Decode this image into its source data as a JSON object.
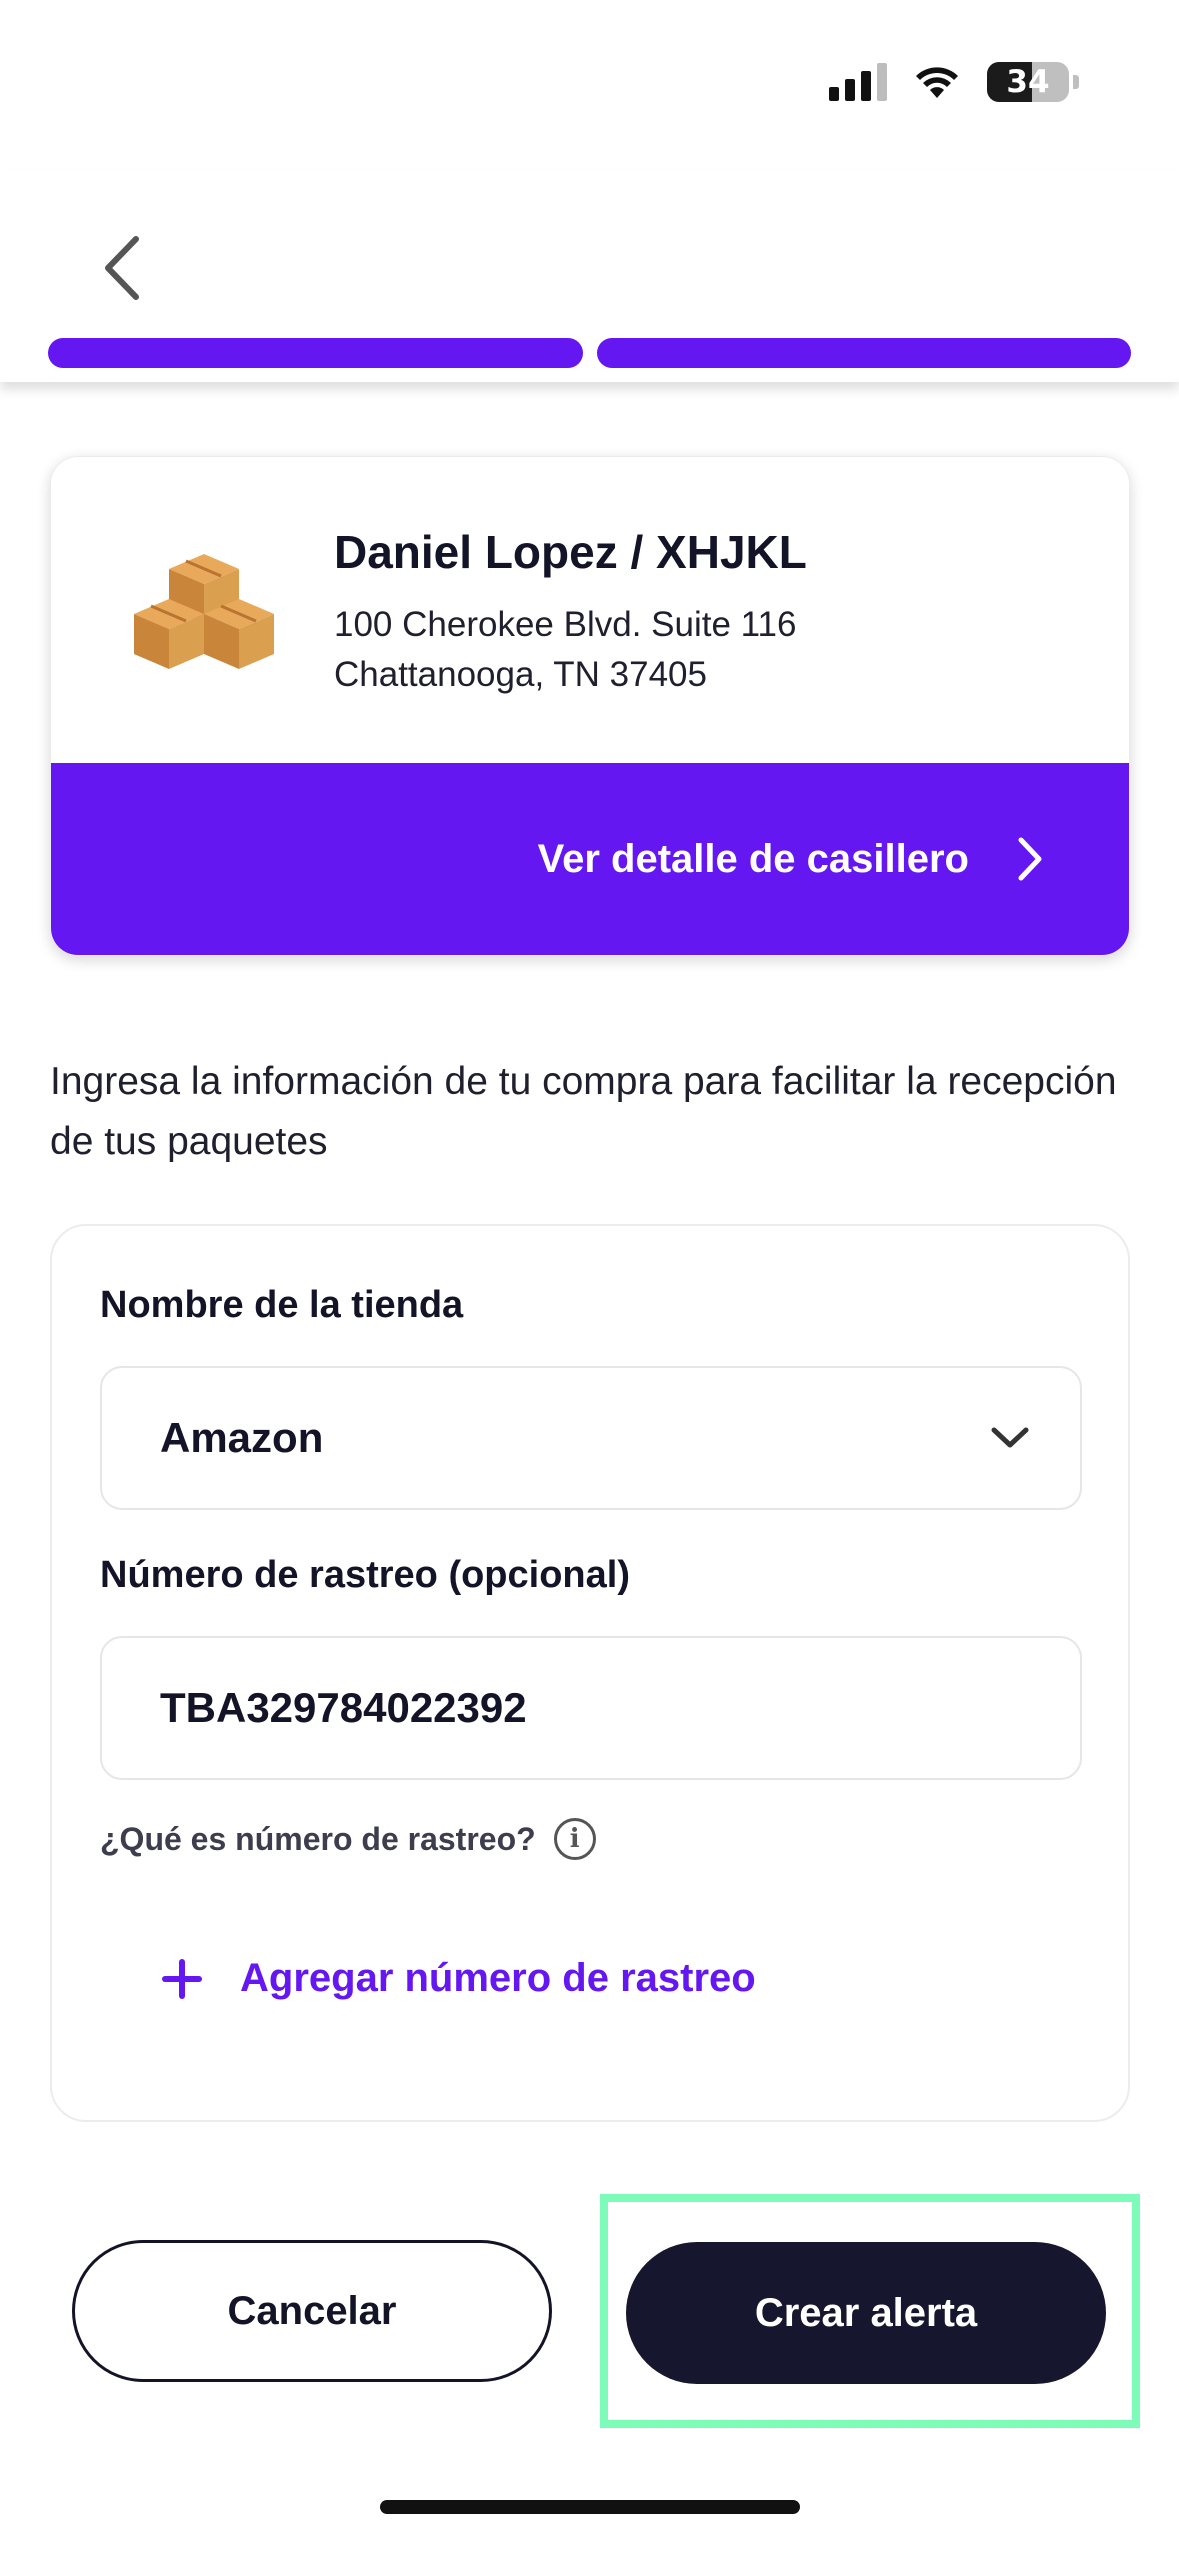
{
  "status_bar": {
    "battery": "34"
  },
  "locker": {
    "name": "Daniel Lopez / XHJKL",
    "address_line1": "100 Cherokee Blvd. Suite 116",
    "address_line2": "Chattanooga, TN 37405",
    "detail_link": "Ver detalle de casillero",
    "icon": "boxes-icon"
  },
  "instructions": "Ingresa la información de tu compra para facilitar la recepción de tus paquetes",
  "form": {
    "store_label": "Nombre de la tienda",
    "store_value": "Amazon",
    "tracking_label": "Número de rastreo (opcional)",
    "tracking_value": "TBA329784022392",
    "help_text": "¿Qué es número de rastreo?",
    "add_tracking": "Agregar número de rastreo"
  },
  "actions": {
    "cancel": "Cancelar",
    "create": "Crear alerta"
  },
  "colors": {
    "accent": "#6417f0",
    "dark": "#16162e",
    "highlight": "#7dfbb8"
  }
}
